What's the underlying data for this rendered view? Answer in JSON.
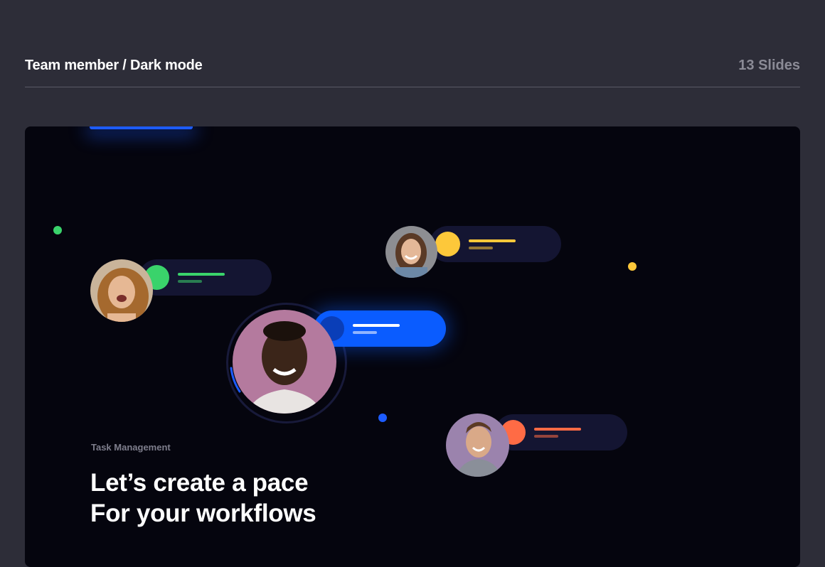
{
  "header": {
    "title": "Team member / Dark mode",
    "count": "13 Slides"
  },
  "slide": {
    "eyebrow": "Task Management",
    "headline_line1": "Let’s create a pace",
    "headline_line2": "For your workflows"
  },
  "colors": {
    "page_bg": "#2d2d38",
    "slide_bg": "#05050e",
    "accent_blue": "#0a5cff",
    "green": "#3ad36b",
    "yellow": "#fdc83a",
    "orange": "#ff6b45"
  },
  "icons": [
    "avatar-photo",
    "status-dot"
  ]
}
